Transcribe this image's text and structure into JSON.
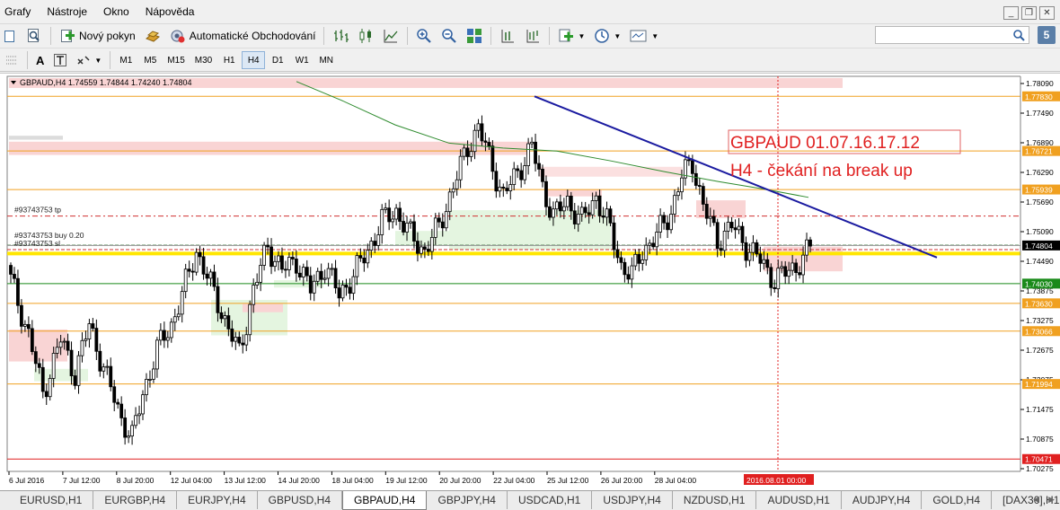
{
  "menu": {
    "items": [
      "Grafy",
      "Nástroje",
      "Okno",
      "Nápověda"
    ]
  },
  "toolbar": {
    "new_order_label": "Nový pokyn",
    "auto_trading_label": "Automatické Obchodování"
  },
  "timeframes": [
    "M1",
    "M5",
    "M15",
    "M30",
    "H1",
    "H4",
    "D1",
    "W1",
    "MN"
  ],
  "active_timeframe": "H4",
  "drawing_tools": {
    "text_label": "A"
  },
  "help_label": "5",
  "chart": {
    "header": "GBPAUD,H4  1.74559 1.74844 1.74240 1.74804",
    "annotation_line1": "GBPAUD 01.07.16.17.12",
    "annotation_line2": "H4 - čekání na break up",
    "order_labels": [
      "#93743753 tp",
      "#93743753 buy 0.20",
      "#93743753 sl"
    ],
    "price_labels": [
      "1.78090",
      "1.77490",
      "1.76890",
      "1.76290",
      "1.75690",
      "1.75090",
      "1.74490",
      "1.73875",
      "1.73275",
      "1.72675",
      "1.72075",
      "1.71475",
      "1.70875",
      "1.70275"
    ],
    "price_markers": [
      {
        "price": "1.77830",
        "color": "#f0a020"
      },
      {
        "price": "1.76721",
        "color": "#f0a020"
      },
      {
        "price": "1.75939",
        "color": "#f0a020"
      },
      {
        "price": "1.74804",
        "color": "#000000"
      },
      {
        "price": "1.74030",
        "color": "#1a8a1a"
      },
      {
        "price": "1.73630",
        "color": "#f0a020"
      },
      {
        "price": "1.73066",
        "color": "#f0a020"
      },
      {
        "price": "1.71994",
        "color": "#f0a020"
      },
      {
        "price": "1.70471",
        "color": "#e02020"
      }
    ],
    "time_labels": [
      "6 Jul 2016",
      "7 Jul 12:00",
      "8 Jul 20:00",
      "12 Jul 04:00",
      "13 Jul 12:00",
      "14 Jul 20:00",
      "18 Jul 04:00",
      "19 Jul 12:00",
      "20 Jul 20:00",
      "22 Jul 04:00",
      "25 Jul 12:00",
      "26 Jul 20:00",
      "28 Jul 04:00"
    ],
    "cursor_time": "2016.08.01 00:00",
    "colors": {
      "trendline": "#1a1aa0",
      "ma": "#2e8b2e",
      "support": "#f0a020",
      "annotation": "#e02020"
    }
  },
  "tabs": [
    "EURUSD,H1",
    "EURGBP,H4",
    "EURJPY,H4",
    "GBPUSD,H4",
    "GBPAUD,H4",
    "GBPJPY,H4",
    "USDCAD,H1",
    "USDJPY,H4",
    "NZDUSD,H1",
    "AUDUSD,H1",
    "AUDJPY,H4",
    "GOLD,H4",
    "[DAX30],H1"
  ],
  "active_tab": "GBPAUD,H4"
}
